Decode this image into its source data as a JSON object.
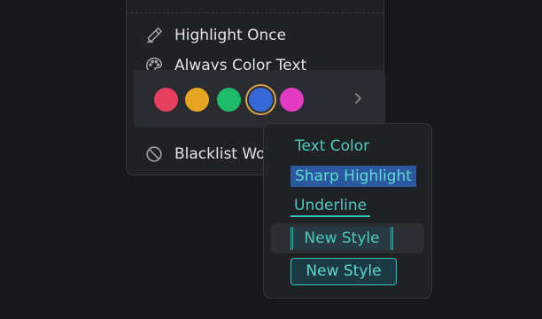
{
  "menu": {
    "highlight_once": {
      "label": "Highlight Once",
      "icon": "highlighter-icon"
    },
    "always_color": {
      "label": "Always Color Text",
      "icon": "palette-icon"
    },
    "blacklist": {
      "label": "Blacklist Wo",
      "icon": "block-icon"
    },
    "colors": [
      {
        "name": "red",
        "hex": "#e5405e",
        "selected": false
      },
      {
        "name": "orange",
        "hex": "#e6a523",
        "selected": false
      },
      {
        "name": "green",
        "hex": "#1fbb6a",
        "selected": false
      },
      {
        "name": "blue",
        "hex": "#3868d6",
        "selected": true
      },
      {
        "name": "pink",
        "hex": "#e33bc2",
        "selected": false
      }
    ]
  },
  "submenu": {
    "text_color": "Text Color",
    "sharp_highlight": "Sharp Highlight",
    "underline": "Underline",
    "new_style_bracket": "New Style",
    "new_style_box": "New Style"
  }
}
